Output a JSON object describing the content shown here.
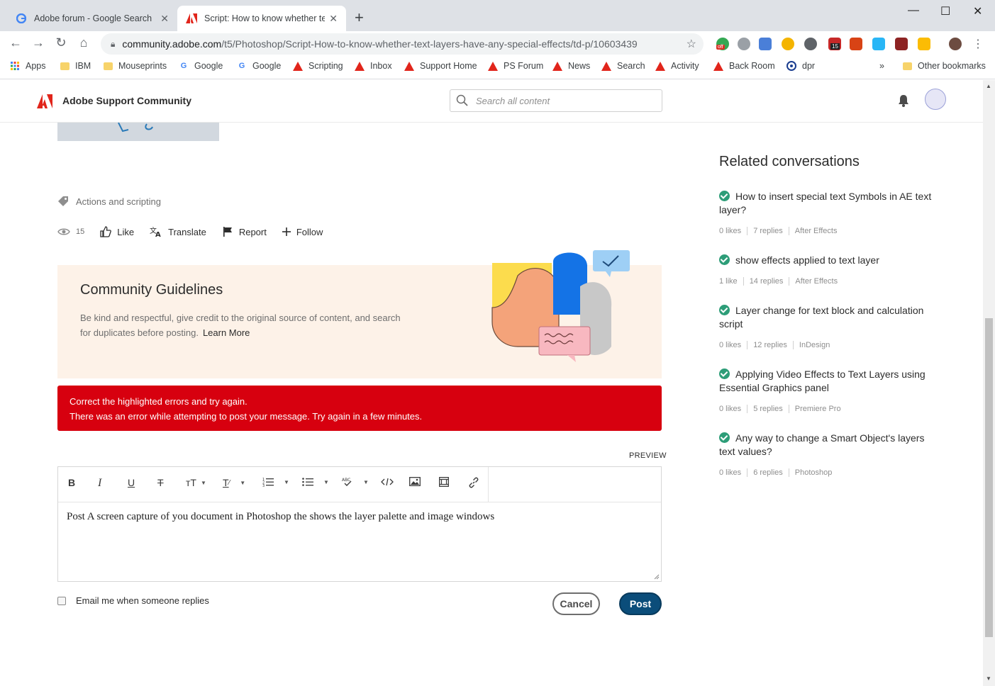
{
  "browser": {
    "tabs": [
      {
        "title": "Adobe forum - Google Search",
        "active": false
      },
      {
        "title": "Script: How to know whether text",
        "active": true
      }
    ],
    "url_domain": "community.adobe.com",
    "url_path": "/t5/Photoshop/Script-How-to-know-whether-text-layers-have-any-special-effects/td-p/10603439",
    "extension_badge": "15",
    "extension_off": "off",
    "bookmarks": [
      {
        "label": "Apps",
        "icon": "apps-grid-icon"
      },
      {
        "label": "IBM",
        "icon": "folder-icon"
      },
      {
        "label": "Mouseprints",
        "icon": "folder-icon"
      },
      {
        "label": "Google",
        "icon": "google-icon"
      },
      {
        "label": "Google",
        "icon": "google-icon"
      },
      {
        "label": "Scripting",
        "icon": "adobe-icon"
      },
      {
        "label": "Inbox",
        "icon": "adobe-icon"
      },
      {
        "label": "Support Home",
        "icon": "adobe-icon"
      },
      {
        "label": "PS Forum",
        "icon": "adobe-icon"
      },
      {
        "label": "News",
        "icon": "adobe-icon"
      },
      {
        "label": "Search",
        "icon": "adobe-icon"
      },
      {
        "label": "Activity",
        "icon": "adobe-icon"
      },
      {
        "label": "Back Room",
        "icon": "adobe-icon"
      },
      {
        "label": "dpr",
        "icon": "dpr-icon"
      }
    ],
    "overflow": "»",
    "other_bookmarks": "Other bookmarks"
  },
  "site": {
    "name": "Adobe Support Community",
    "search_placeholder": "Search all content"
  },
  "post": {
    "label": "Actions and scripting",
    "views": "15",
    "actions": {
      "like": "Like",
      "translate": "Translate",
      "report": "Report",
      "follow": "Follow"
    }
  },
  "guidelines": {
    "title": "Community Guidelines",
    "text": "Be kind and respectful, give credit to the original source of content, and search for duplicates before posting.",
    "link": "Learn More"
  },
  "error": {
    "line1": "Correct the highlighted errors and try again.",
    "line2": "There was an error while attempting to post your message. Try again in a few minutes."
  },
  "editor": {
    "preview_label": "PREVIEW",
    "content": "Post A screen capture of you document in Photoshop the shows the layer palette and image windows",
    "email_label": "Email me when someone replies",
    "cancel_label": "Cancel",
    "post_label": "Post"
  },
  "related": {
    "heading": "Related conversations",
    "items": [
      {
        "title": "How to insert special text Symbols in AE text layer?",
        "likes": "0 likes",
        "replies": "7 replies",
        "board": "After Effects"
      },
      {
        "title": "show effects applied to text layer",
        "likes": "1 like",
        "replies": "14 replies",
        "board": "After Effects"
      },
      {
        "title": "Layer change for text block and calculation script",
        "likes": "0 likes",
        "replies": "12 replies",
        "board": "InDesign"
      },
      {
        "title": "Applying Video Effects to Text Layers using Essential Graphics panel",
        "likes": "0 likes",
        "replies": "5 replies",
        "board": "Premiere Pro"
      },
      {
        "title": "Any way to change a Smart Object's layers text values?",
        "likes": "0 likes",
        "replies": "6 replies",
        "board": "Photoshop"
      }
    ]
  },
  "colors": {
    "adobe_red": "#e1251b",
    "error_bg": "#d7000f",
    "post_button": "#0b4d7a",
    "solved_check": "#2d9d78",
    "guidelines_bg": "#fdf2e8"
  }
}
